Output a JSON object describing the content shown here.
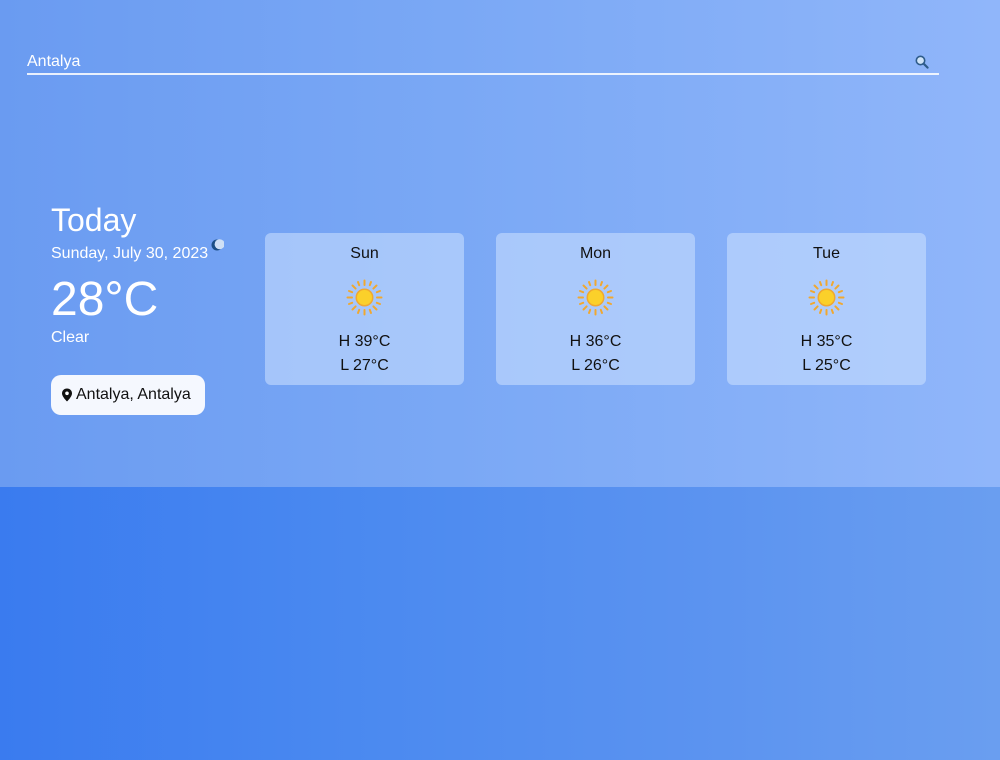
{
  "search": {
    "value": "Antalya",
    "placeholder": ""
  },
  "today": {
    "title": "Today",
    "date": "Sunday, July 30, 2023",
    "temperature": "28°C",
    "condition": "Clear",
    "condition_icon": "moon-icon",
    "location": "Antalya, Antalya"
  },
  "forecast": [
    {
      "day": "Sun",
      "high": "H 39°C",
      "low": "L 27°C",
      "icon": "sun-icon"
    },
    {
      "day": "Mon",
      "high": "H 36°C",
      "low": "L 26°C",
      "icon": "sun-icon"
    },
    {
      "day": "Tue",
      "high": "H 35°C",
      "low": "L 25°C",
      "icon": "sun-icon"
    }
  ],
  "colors": {
    "panel_start": "#6a9bf1",
    "panel_end": "#90b6fa",
    "background_start": "#3a7bef",
    "background_end": "#6a9ef0",
    "sun": "#fbd02a",
    "sun_rays": "#f0a830"
  }
}
